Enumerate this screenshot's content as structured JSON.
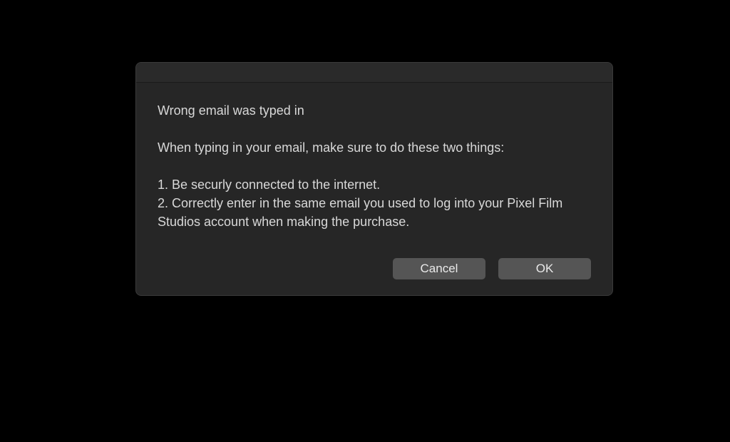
{
  "dialog": {
    "heading": "Wrong email was typed in",
    "instruction": "When typing in your email, make sure to do these two things:",
    "items": [
      "1. Be securly connected to the internet.",
      "2. Correctly enter in the same email you used to log into your Pixel Film Studios account when making the purchase."
    ],
    "buttons": {
      "cancel": "Cancel",
      "ok": "OK"
    }
  }
}
